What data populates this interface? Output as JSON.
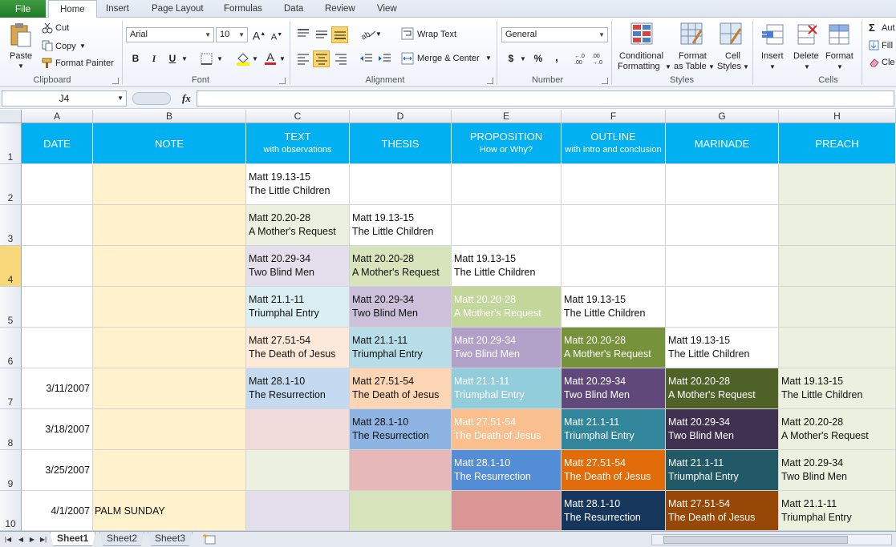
{
  "tabs": {
    "file": "File",
    "items": [
      "Home",
      "Insert",
      "Page Layout",
      "Formulas",
      "Data",
      "Review",
      "View"
    ]
  },
  "ribbon": {
    "clipboard": {
      "paste": "Paste",
      "cut": "Cut",
      "copy": "Copy",
      "format_painter": "Format Painter",
      "label": "Clipboard"
    },
    "font": {
      "name": "Arial",
      "size": "10",
      "label": "Font",
      "bold": "B",
      "italic": "I",
      "underline": "U"
    },
    "alignment": {
      "wrap_text": "Wrap Text",
      "merge_center": "Merge & Center",
      "label": "Alignment"
    },
    "number": {
      "format": "General",
      "label": "Number",
      "currency": "$",
      "percent": "%",
      "comma": ","
    },
    "styles": {
      "conditional_1": "Conditional",
      "conditional_2": "Formatting",
      "format_table_1": "Format",
      "format_table_2": "as Table",
      "cell_styles_1": "Cell",
      "cell_styles_2": "Styles",
      "label": "Styles"
    },
    "cells": {
      "insert": "Insert",
      "delete": "Delete",
      "format": "Format",
      "label": "Cells"
    },
    "editing": {
      "autosum": "Aut",
      "fill": "Fill",
      "clear": "Cle"
    }
  },
  "formula_bar": {
    "name_box": "J4",
    "fx": "fx",
    "value": ""
  },
  "columns": [
    "A",
    "B",
    "C",
    "D",
    "E",
    "F",
    "G",
    "H"
  ],
  "rows": [
    "1",
    "2",
    "3",
    "4",
    "5",
    "6",
    "7",
    "8",
    "9",
    "10"
  ],
  "header_row": [
    {
      "main": "DATE",
      "sub": ""
    },
    {
      "main": "NOTE",
      "sub": ""
    },
    {
      "main": "TEXT",
      "sub": "with observations"
    },
    {
      "main": "THESIS",
      "sub": ""
    },
    {
      "main": "PROPOSITION",
      "sub": "How or Why?"
    },
    {
      "main": "OUTLINE",
      "sub": "with intro and conclusion"
    },
    {
      "main": "MARINADE",
      "sub": ""
    },
    {
      "main": "PREACH",
      "sub": ""
    }
  ],
  "dates": [
    "",
    "",
    "",
    "",
    "",
    "3/11/2007",
    "3/18/2007",
    "3/25/2007",
    "4/1/2007"
  ],
  "notes": [
    "",
    "",
    "",
    "",
    "",
    "",
    "",
    "",
    "PALM SUNDAY"
  ],
  "passages": [
    {
      "ref": "Matt 19.13-15",
      "title": "The Little Children"
    },
    {
      "ref": "Matt 20.20-28",
      "title": "A Mother's Request"
    },
    {
      "ref": "Matt 20.29-34",
      "title": "Two Blind Men"
    },
    {
      "ref": "Matt 21.1-11",
      "title": "Triumphal Entry"
    },
    {
      "ref": "Matt 27.51-54",
      "title": "The Death of Jesus"
    },
    {
      "ref": "Matt 28.1-10",
      "title": "The Resurrection"
    }
  ],
  "sheets": [
    "Sheet1",
    "Sheet2",
    "Sheet3"
  ],
  "colors": {
    "header": "#00b0f0",
    "note_bg": "#fff2cc",
    "preach_bg": "#ebf1de",
    "text_col": [
      "#ffffff",
      "#ebf1de",
      "#e4dfec",
      "#daeef3",
      "#fde9d9",
      "#c5d9f1",
      "#f2dcdb",
      "#ebf1de",
      "#e4dfec"
    ],
    "thesis_col": [
      "#ffffff",
      "#ffffff",
      "#d8e4bc",
      "#ccc0da",
      "#b7dee8",
      "#fcd5b4",
      "#8db4e2",
      "#e6b8b7",
      "#d8e4bc"
    ],
    "prop_col": [
      "#ffffff",
      "#ffffff",
      "#ffffff",
      "#c4d79b",
      "#b1a0c7",
      "#92cddc",
      "#fabf8f",
      "#538dd5",
      "#da9694"
    ],
    "outline_col": [
      "#ffffff",
      "#ffffff",
      "#ffffff",
      "#ffffff",
      "#76933c",
      "#60497a",
      "#31869b",
      "#e26b0a",
      "#16365c"
    ],
    "marinade_col": [
      "#ffffff",
      "#ffffff",
      "#ffffff",
      "#ffffff",
      "#ffffff",
      "#4f6228",
      "#403151",
      "#215967",
      "#974706"
    ]
  }
}
